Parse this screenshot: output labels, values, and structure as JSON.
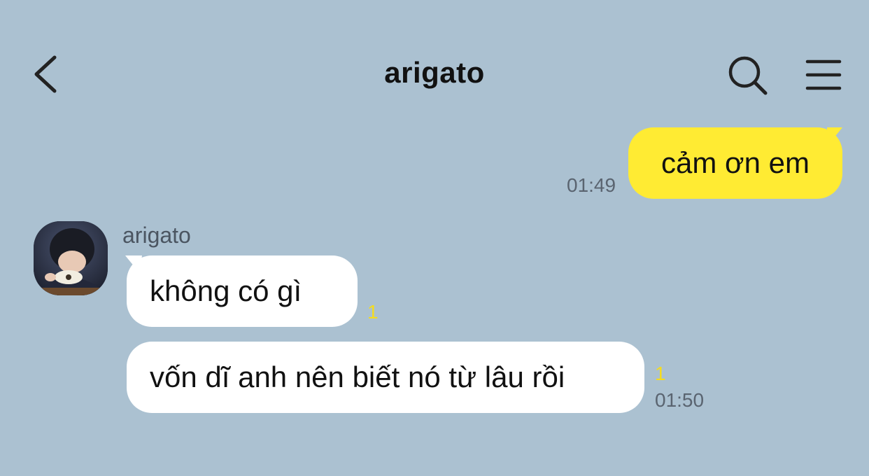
{
  "header": {
    "title": "arigato",
    "back_icon": "chevron-left-icon",
    "search_icon": "search-icon",
    "menu_icon": "hamburger-menu-icon"
  },
  "colors": {
    "background": "#abc1d1",
    "sent_bubble": "#ffeb33",
    "received_bubble": "#ffffff",
    "unread_count": "#f5dc1e"
  },
  "messages": {
    "sent": [
      {
        "text": "cảm ơn em",
        "time": "01:49"
      }
    ],
    "received": {
      "sender": "arigato",
      "items": [
        {
          "text": "không có gì",
          "unread": "1"
        },
        {
          "text": "vốn dĩ anh nên biết nó từ lâu rồi",
          "unread": "1",
          "time": "01:50"
        }
      ]
    }
  }
}
